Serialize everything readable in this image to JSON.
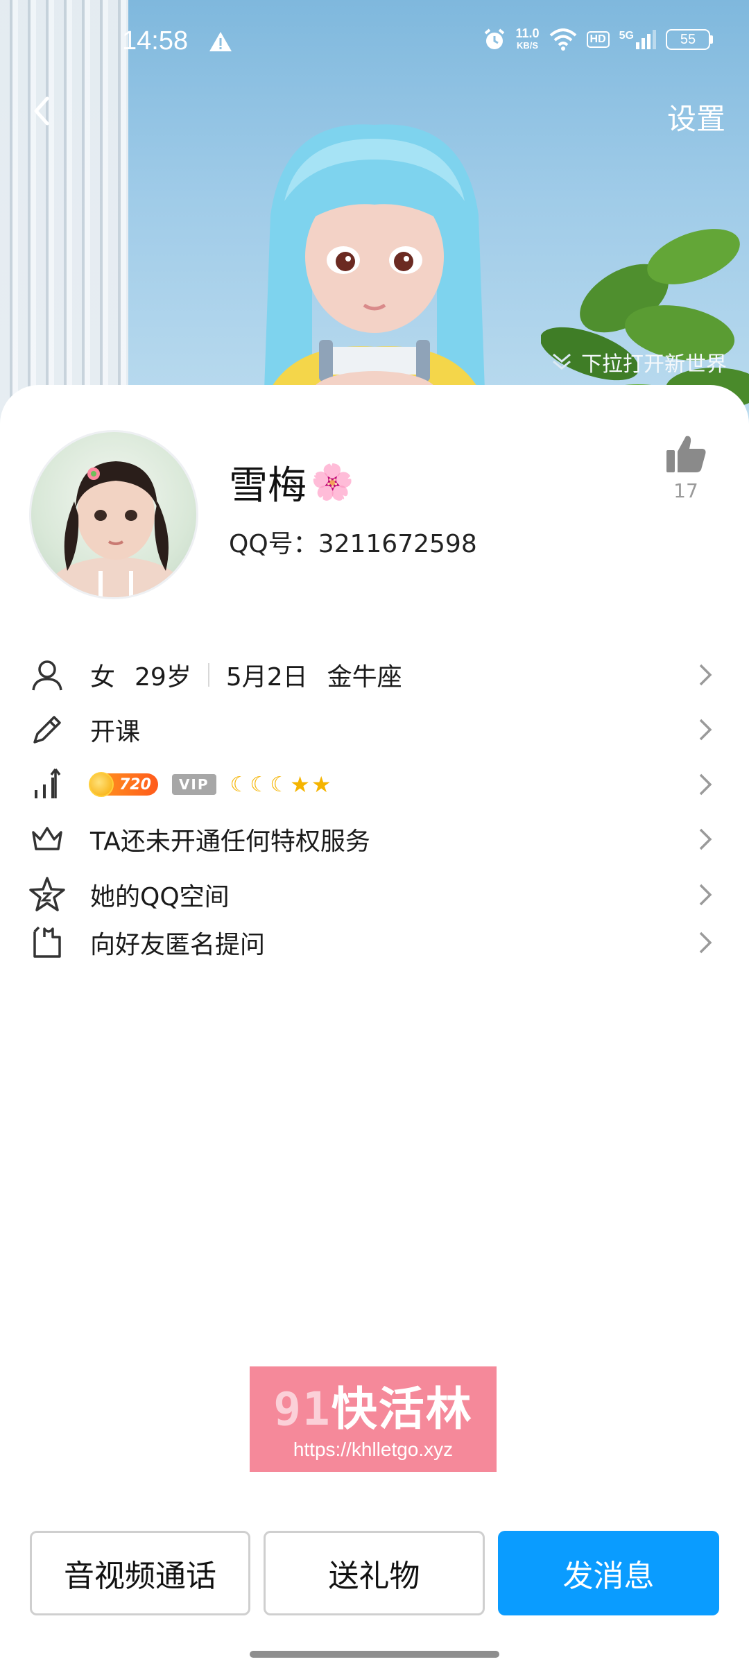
{
  "status_bar": {
    "time": "14:58",
    "net_speed_value": "11.0",
    "net_speed_unit": "KB/S",
    "hd_label": "HD",
    "signal_label": "5G",
    "battery_level": "55"
  },
  "header": {
    "settings_label": "设置",
    "pull_hint": "下拉打开新世界"
  },
  "profile": {
    "nickname": "雪梅",
    "nickname_emoji": "🌸",
    "qq_label": "QQ号：",
    "qq_number": "3211672598",
    "like_count": "17"
  },
  "info_rows": {
    "gender": "女",
    "age": "29岁",
    "birthday": "5月2日",
    "zodiac": "金牛座",
    "course": "开课",
    "level_number": "720",
    "vip_label": "VIP",
    "privilege": "TA还未开通任何特权服务",
    "qzone": "她的QQ空间",
    "anon_question": "向好友匿名提问"
  },
  "watermark": {
    "number": "91",
    "title": "快活林",
    "url": "https://khlletgo.xyz"
  },
  "actions": {
    "call": "音视频通话",
    "gift": "送礼物",
    "message": "发消息"
  },
  "colors": {
    "primary": "#0a9cff",
    "level_badge": "#ff7a1c",
    "watermark_bg": "#f5899a"
  }
}
